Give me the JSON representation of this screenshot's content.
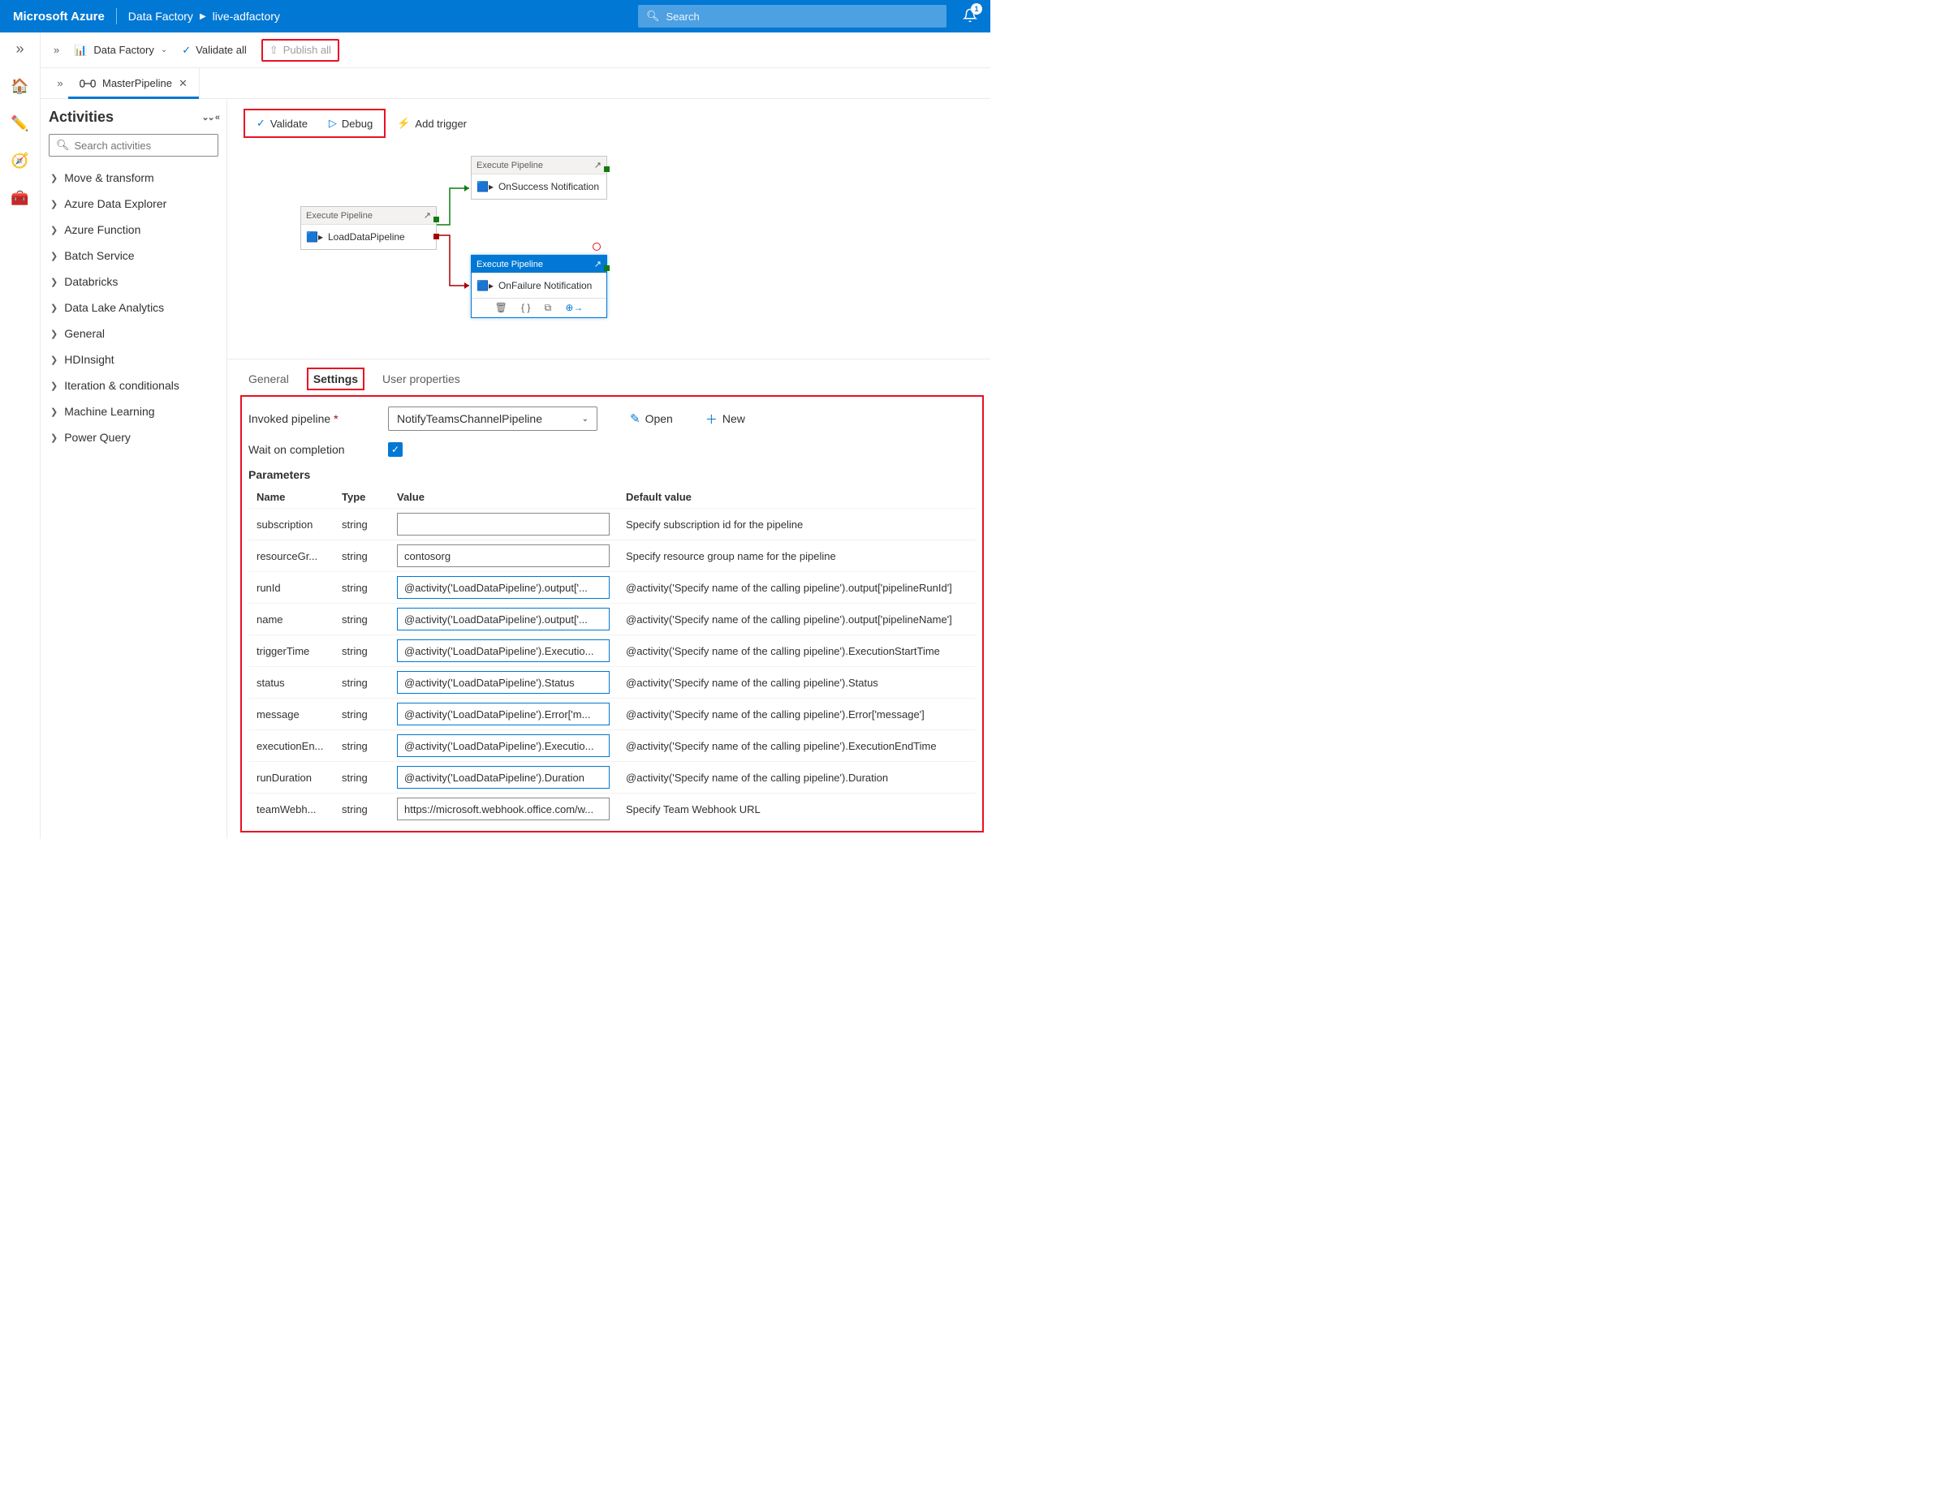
{
  "header": {
    "brand": "Microsoft Azure",
    "service": "Data Factory",
    "resource": "live-adfactory",
    "search_placeholder": "Search",
    "bell_badge": "1"
  },
  "commandbar": {
    "df_label": "Data Factory",
    "validate_all": "Validate all",
    "publish_all": "Publish all"
  },
  "tab": {
    "title": "MasterPipeline",
    "close": "✕"
  },
  "sidebar": {
    "title": "Activities",
    "search_placeholder": "Search activities",
    "categories": [
      "Move & transform",
      "Azure Data Explorer",
      "Azure Function",
      "Batch Service",
      "Databricks",
      "Data Lake Analytics",
      "General",
      "HDInsight",
      "Iteration & conditionals",
      "Machine Learning",
      "Power Query"
    ]
  },
  "canvas_tools": {
    "validate": "Validate",
    "debug": "Debug",
    "add_trigger": "Add trigger"
  },
  "nodes": {
    "load": {
      "type": "Execute Pipeline",
      "name": "LoadDataPipeline"
    },
    "success": {
      "type": "Execute Pipeline",
      "name": "OnSuccess Notification"
    },
    "failure": {
      "type": "Execute Pipeline",
      "name": "OnFailure Notification"
    }
  },
  "panel_tabs": {
    "general": "General",
    "settings": "Settings",
    "user_props": "User properties"
  },
  "settings": {
    "invoked_label": "Invoked pipeline",
    "invoked_value": "NotifyTeamsChannelPipeline",
    "open": "Open",
    "new": "New",
    "wait_label": "Wait on completion",
    "params_title": "Parameters",
    "cols": {
      "name": "Name",
      "type": "Type",
      "value": "Value",
      "default": "Default value"
    },
    "rows": [
      {
        "name": "subscription",
        "type": "string",
        "value": "",
        "expr": false,
        "default": "Specify subscription id for the pipeline"
      },
      {
        "name": "resourceGr...",
        "type": "string",
        "value": "contosorg",
        "expr": false,
        "default": "Specify resource group name for the pipeline"
      },
      {
        "name": "runId",
        "type": "string",
        "value": "@activity('LoadDataPipeline').output['...",
        "expr": true,
        "default": "@activity('Specify name of the calling pipeline').output['pipelineRunId']"
      },
      {
        "name": "name",
        "type": "string",
        "value": "@activity('LoadDataPipeline').output['...",
        "expr": true,
        "default": "@activity('Specify name of the calling pipeline').output['pipelineName']"
      },
      {
        "name": "triggerTime",
        "type": "string",
        "value": "@activity('LoadDataPipeline').Executio...",
        "expr": true,
        "default": "@activity('Specify name of the calling pipeline').ExecutionStartTime"
      },
      {
        "name": "status",
        "type": "string",
        "value": "@activity('LoadDataPipeline').Status",
        "expr": true,
        "default": "@activity('Specify name of the calling pipeline').Status"
      },
      {
        "name": "message",
        "type": "string",
        "value": "@activity('LoadDataPipeline').Error['m...",
        "expr": true,
        "default": "@activity('Specify name of the calling pipeline').Error['message']"
      },
      {
        "name": "executionEn...",
        "type": "string",
        "value": "@activity('LoadDataPipeline').Executio...",
        "expr": true,
        "default": "@activity('Specify name of the calling pipeline').ExecutionEndTime"
      },
      {
        "name": "runDuration",
        "type": "string",
        "value": "@activity('LoadDataPipeline').Duration",
        "expr": true,
        "default": "@activity('Specify name of the calling pipeline').Duration"
      },
      {
        "name": "teamWebh...",
        "type": "string",
        "value": "https://microsoft.webhook.office.com/w...",
        "expr": false,
        "default": "Specify Team Webhook URL"
      }
    ]
  }
}
